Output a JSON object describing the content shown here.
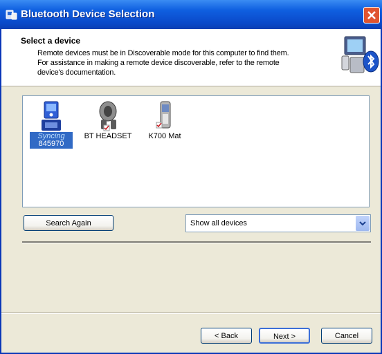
{
  "window": {
    "title": "Bluetooth Device Selection",
    "title_icon": "bluetooth-devices-icon",
    "close_icon": "close-icon"
  },
  "header": {
    "title": "Select a device",
    "line1": "Remote devices must be in Discoverable mode for this computer to find them.",
    "line2": "For assistance in making a remote device discoverable, refer to the remote",
    "line3": "device's documentation.",
    "icon": "computer-bluetooth-icon"
  },
  "devices": [
    {
      "label_line1": "Syncing",
      "label_line2": "845970",
      "icon": "pda-icon",
      "selected": true
    },
    {
      "label": "BT HEADSET",
      "icon": "headset-icon",
      "selected": false
    },
    {
      "label": "K700 Mat",
      "icon": "mobile-phone-icon",
      "selected": false
    }
  ],
  "controls": {
    "search_again": "Search Again",
    "filter": {
      "selected": "Show all devices"
    }
  },
  "footer": {
    "back": "< Back",
    "next": "Next >",
    "cancel": "Cancel"
  },
  "colors": {
    "titlebar": "#0a49c9",
    "selection": "#316ac5",
    "dialog_bg": "#ece9d8"
  }
}
